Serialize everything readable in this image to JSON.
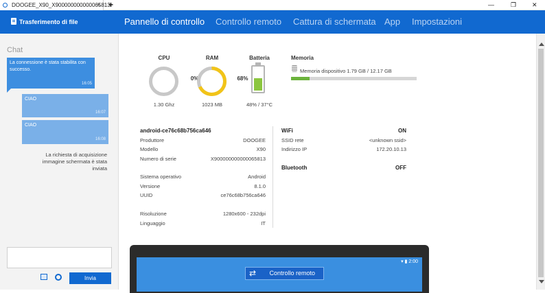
{
  "window": {
    "tab_title": "DOOGEE_X90_X900000000000065813",
    "tab_close": "×",
    "new_tab": "+",
    "minimize": "—",
    "restore": "❐",
    "close": "✕"
  },
  "nav": {
    "file_transfer": "Trasferimento di file",
    "tabs": [
      {
        "label": "Pannello di controllo",
        "active": true
      },
      {
        "label": "Controllo remoto",
        "active": false
      },
      {
        "label": "Cattura di schermata",
        "active": false
      },
      {
        "label": "App",
        "active": false
      },
      {
        "label": "Impostazioni",
        "active": false
      }
    ]
  },
  "chat": {
    "title": "Chat",
    "messages": [
      {
        "text": "La connessione è stata stabilita con successo.",
        "time": "16:05"
      },
      {
        "text": "CIAO",
        "time": "16:07"
      },
      {
        "text": "CIAO",
        "time": "16:08"
      }
    ],
    "system_message": "La richiesta di acquisizione immagine schermata è stata inviata",
    "send_label": "Invia"
  },
  "stats": {
    "cpu": {
      "label": "CPU",
      "value": "0%",
      "percent": 0,
      "sub": "1.30 Ghz"
    },
    "ram": {
      "label": "RAM",
      "value": "68%",
      "percent": 68,
      "sub": "1023 MB"
    },
    "battery": {
      "label": "Batteria",
      "percent": 48,
      "sub": "48% / 37°C"
    },
    "memory": {
      "label": "Memoria",
      "text": "Memoria dispositivo 1.79 GB / 12.17 GB",
      "fraction": 0.147
    }
  },
  "device": {
    "title": "android-ce76c68b756ca646",
    "group1": [
      {
        "k": "Produttore",
        "v": "DOOGEE"
      },
      {
        "k": "Modello",
        "v": "X90"
      },
      {
        "k": "Numero di serie",
        "v": "X900000000000065813"
      }
    ],
    "group2": [
      {
        "k": "Sistema operativo",
        "v": "Android"
      },
      {
        "k": "Versione",
        "v": "8.1.0"
      },
      {
        "k": "UUID",
        "v": "ce76c68b756ca646"
      }
    ],
    "group3": [
      {
        "k": "Risoluzione",
        "v": "1280x600 - 232dpi"
      },
      {
        "k": "Linguaggio",
        "v": "IT"
      }
    ]
  },
  "network": {
    "wifi_label": "WiFi",
    "wifi_status": "ON",
    "ssid_label": "SSID rete",
    "ssid_value": "<unknown ssid>",
    "ip_label": "Indirizzo IP",
    "ip_value": "172.20.10.13",
    "bt_label": "Bluetooth",
    "bt_status": "OFF"
  },
  "preview": {
    "status_time": "2:00",
    "remote_button": "Controllo remoto"
  },
  "colors": {
    "accent": "#1169d0",
    "ram_ring": "#f2c418",
    "battery_fill": "#8cc63f",
    "memory_fill": "#6bb33c"
  }
}
